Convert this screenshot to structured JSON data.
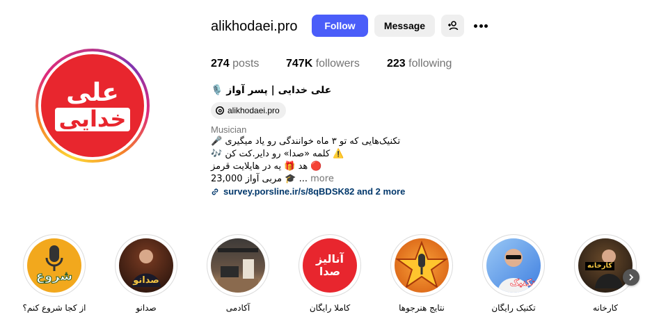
{
  "profile": {
    "username": "alikhodaei.pro",
    "avatar_text_line1": "علی",
    "avatar_text_line2": "خدایی",
    "follow_label": "Follow",
    "message_label": "Message",
    "suggest_icon": "person-add-icon",
    "more_icon": "more-options-icon"
  },
  "stats": {
    "posts_count": "274",
    "posts_label": "posts",
    "followers_count": "747K",
    "followers_label": "followers",
    "following_count": "223",
    "following_label": "following"
  },
  "bio": {
    "full_name": "علی خدایی | پسر آواز 🎙️",
    "threads_handle": "alikhodaei.pro",
    "category": "Musician",
    "line1": "🎤 تکنیک‌هایی که تو ۳ ماه خوانندگی رو یاد میگیری",
    "line2": "🎶 کلمه «صدا» رو دایر.کت کن ⚠️",
    "line3": "هد 🎁 یه در هایلایت قرمز 🔴",
    "line4": "23,000 مربی آواز 🎓 ...",
    "more_label": "more",
    "link_text": "survey.porsline.ir/s/8qBDSK82 and 2 more"
  },
  "highlights": [
    {
      "label": "از کجا شروع کنم؟",
      "art_text": "شروع",
      "bg": "#f2a81d",
      "fg": "#ffffff"
    },
    {
      "label": "صدانو",
      "art_text": "صدانو",
      "bg": "#3a1f14",
      "fg": "#f4c542"
    },
    {
      "label": "آکادمی",
      "art_text": "",
      "bg": "#5b4a3c",
      "fg": "#ffffff"
    },
    {
      "label": "کاملا رایگان",
      "art_text": "آنالیز صدا",
      "bg": "#e8262e",
      "fg": "#ffffff"
    },
    {
      "label": "نتایج هنرجوها",
      "art_text": "★",
      "bg": "#f07a1a",
      "fg": "#ffd54a"
    },
    {
      "label": "تکنیک رایگان",
      "art_text": "تکنیک",
      "bg": "#3f7fe0",
      "fg": "#ffffff"
    },
    {
      "label": "کارخانه",
      "art_text": "کارخانه",
      "bg": "#2a2a2a",
      "fg": "#f4c542"
    }
  ],
  "colors": {
    "follow_button": "#4a5df9",
    "link": "#00376b",
    "secondary_text": "#737373"
  }
}
